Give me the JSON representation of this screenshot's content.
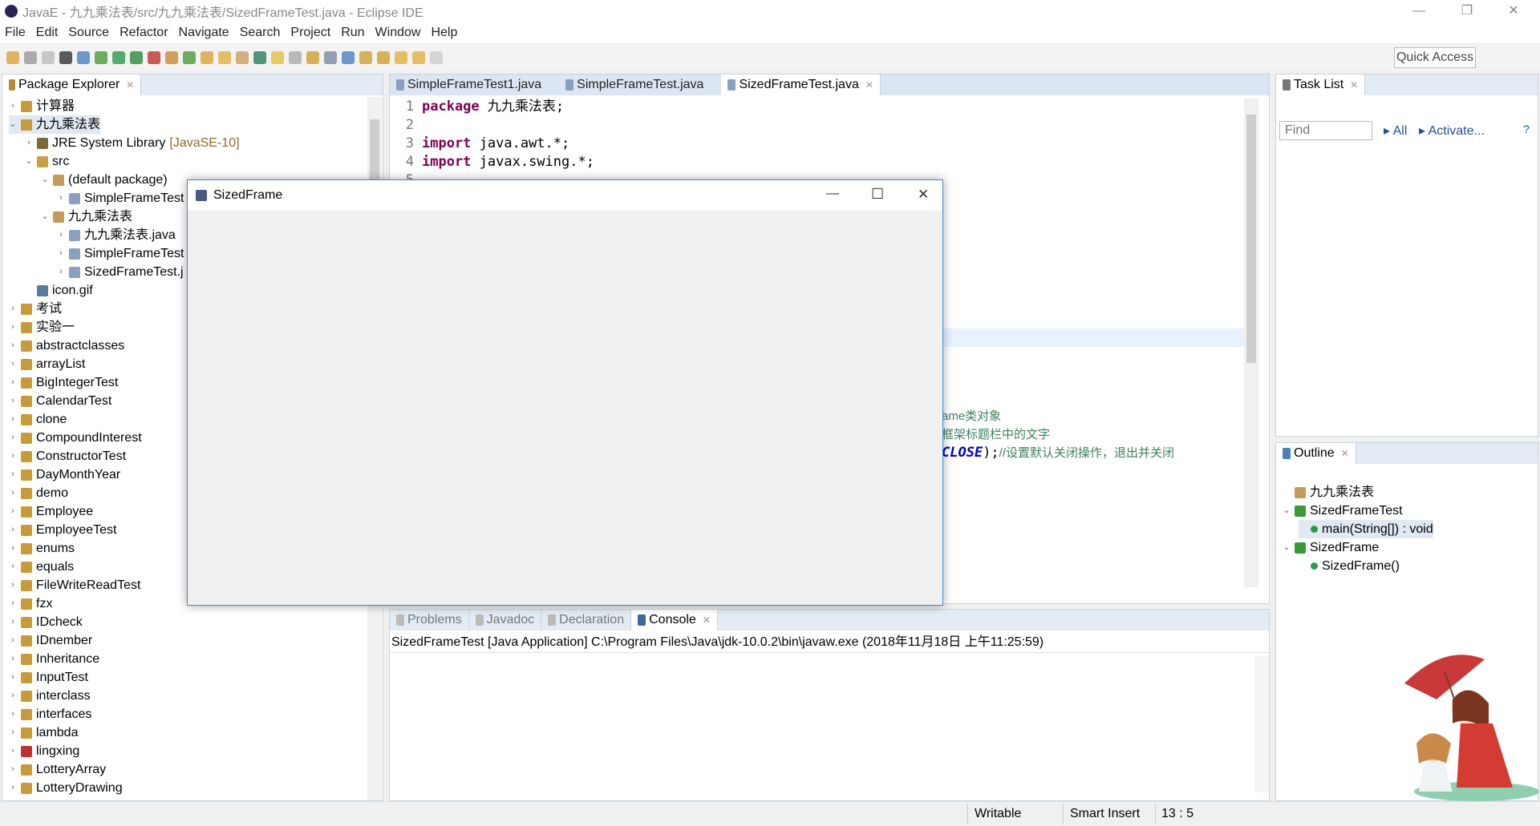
{
  "window": {
    "title": "JavaE - 九九乘法表/src/九九乘法表/SizedFrameTest.java - Eclipse IDE",
    "minimize": "—",
    "restore": "❐",
    "close": "✕"
  },
  "menu": [
    "File",
    "Edit",
    "Source",
    "Refactor",
    "Navigate",
    "Search",
    "Project",
    "Run",
    "Window",
    "Help"
  ],
  "quick_access": "Quick Access",
  "package_explorer": {
    "title": "Package Explorer",
    "items": [
      {
        "d": 0,
        "t": "›",
        "label": "计算器",
        "icon": "project"
      },
      {
        "d": 0,
        "t": "⌄",
        "label": "九九乘法表",
        "icon": "project",
        "sel": true
      },
      {
        "d": 1,
        "t": "›",
        "label": "JRE System Library",
        "extra": "[JavaSE-10]",
        "icon": "library"
      },
      {
        "d": 1,
        "t": "⌄",
        "label": "src",
        "icon": "folder"
      },
      {
        "d": 2,
        "t": "⌄",
        "label": "(default package)",
        "icon": "package"
      },
      {
        "d": 3,
        "t": "›",
        "label": "SimpleFrameTest",
        "icon": "java"
      },
      {
        "d": 2,
        "t": "⌄",
        "label": "九九乘法表",
        "icon": "package"
      },
      {
        "d": 3,
        "t": "›",
        "label": "九九乘法表.java",
        "icon": "java"
      },
      {
        "d": 3,
        "t": "›",
        "label": "SimpleFrameTest",
        "icon": "java"
      },
      {
        "d": 3,
        "t": "›",
        "label": "SizedFrameTest.j",
        "icon": "java"
      },
      {
        "d": 1,
        "t": "",
        "label": "icon.gif",
        "icon": "file"
      },
      {
        "d": 0,
        "t": "›",
        "label": "考试",
        "icon": "project"
      },
      {
        "d": 0,
        "t": "›",
        "label": "实验一",
        "icon": "project"
      },
      {
        "d": 0,
        "t": "›",
        "label": "abstractclasses",
        "icon": "project"
      },
      {
        "d": 0,
        "t": "›",
        "label": "arrayList",
        "icon": "project"
      },
      {
        "d": 0,
        "t": "›",
        "label": "BigIntegerTest",
        "icon": "project"
      },
      {
        "d": 0,
        "t": "›",
        "label": "CalendarTest",
        "icon": "project"
      },
      {
        "d": 0,
        "t": "›",
        "label": "clone",
        "icon": "project"
      },
      {
        "d": 0,
        "t": "›",
        "label": "CompoundInterest",
        "icon": "project"
      },
      {
        "d": 0,
        "t": "›",
        "label": "ConstructorTest",
        "icon": "project"
      },
      {
        "d": 0,
        "t": "›",
        "label": "DayMonthYear",
        "icon": "project"
      },
      {
        "d": 0,
        "t": "›",
        "label": "demo",
        "icon": "project"
      },
      {
        "d": 0,
        "t": "›",
        "label": "Employee",
        "icon": "project"
      },
      {
        "d": 0,
        "t": "›",
        "label": "EmployeeTest",
        "icon": "project"
      },
      {
        "d": 0,
        "t": "›",
        "label": "enums",
        "icon": "project"
      },
      {
        "d": 0,
        "t": "›",
        "label": "equals",
        "icon": "project"
      },
      {
        "d": 0,
        "t": "›",
        "label": "FileWriteReadTest",
        "icon": "project"
      },
      {
        "d": 0,
        "t": "›",
        "label": "fzx",
        "icon": "project"
      },
      {
        "d": 0,
        "t": "›",
        "label": "IDcheck",
        "icon": "project"
      },
      {
        "d": 0,
        "t": "›",
        "label": "IDnember",
        "icon": "project"
      },
      {
        "d": 0,
        "t": "›",
        "label": "Inheritance",
        "icon": "project"
      },
      {
        "d": 0,
        "t": "›",
        "label": "InputTest",
        "icon": "project"
      },
      {
        "d": 0,
        "t": "›",
        "label": "interclass",
        "icon": "project"
      },
      {
        "d": 0,
        "t": "›",
        "label": "interfaces",
        "icon": "project"
      },
      {
        "d": 0,
        "t": "›",
        "label": "lambda",
        "icon": "project"
      },
      {
        "d": 0,
        "t": "›",
        "label": "lingxing",
        "icon": "project-error"
      },
      {
        "d": 0,
        "t": "›",
        "label": "LotteryArray",
        "icon": "project"
      },
      {
        "d": 0,
        "t": "›",
        "label": "LotteryDrawing",
        "icon": "project"
      }
    ]
  },
  "editor": {
    "tabs": [
      "SimpleFrameTest1.java",
      "SimpleFrameTest.java",
      "SizedFrameTest.java"
    ],
    "active_tab": 2,
    "lines": [
      {
        "n": "1",
        "kw": "package",
        "rest": " 九九乘法表;"
      },
      {
        "n": "2",
        "kw": "",
        "rest": ""
      },
      {
        "n": "3",
        "kw": "import",
        "rest": " java.awt.*;"
      },
      {
        "n": "4",
        "kw": "import",
        "rest": " javax.swing.*;"
      },
      {
        "n": "5",
        "kw": "",
        "rest": ""
      }
    ],
    "partial": [
      "ame类对象",
      "框架标题栏中的文字",
      "CLOSE);//设置默认关闭操作，退出并关闭"
    ]
  },
  "sized_frame": {
    "title": "SizedFrame",
    "minimize": "—",
    "maximize": "☐",
    "close": "✕"
  },
  "bottom": {
    "tabs": [
      "Problems",
      "Javadoc",
      "Declaration",
      "Console"
    ],
    "active_tab": 3,
    "console_header": "SizedFrameTest [Java Application] C:\\Program Files\\Java\\jdk-10.0.2\\bin\\javaw.exe (2018年11月18日 上午11:25:59)"
  },
  "task_list": {
    "title": "Task List",
    "find_placeholder": "Find",
    "all": "All",
    "activate": "Activate..."
  },
  "outline": {
    "title": "Outline",
    "items": [
      {
        "d": 0,
        "t": "",
        "label": "九九乘法表",
        "icon": "package"
      },
      {
        "d": 0,
        "t": "⌄",
        "label": "SizedFrameTest",
        "icon": "class"
      },
      {
        "d": 1,
        "t": "",
        "label": "main(String[]) : void",
        "icon": "method",
        "sel": true
      },
      {
        "d": 0,
        "t": "⌄",
        "label": "SizedFrame",
        "icon": "class"
      },
      {
        "d": 1,
        "t": "",
        "label": "SizedFrame()",
        "icon": "method"
      }
    ]
  },
  "status": {
    "writable": "Writable",
    "insert": "Smart Insert",
    "position": "13 : 5"
  },
  "colors": {
    "accent": "#3c8ad6",
    "keyword": "#7f0055",
    "comment": "#3f7f5f",
    "panel_header": "#e3ebf5"
  }
}
